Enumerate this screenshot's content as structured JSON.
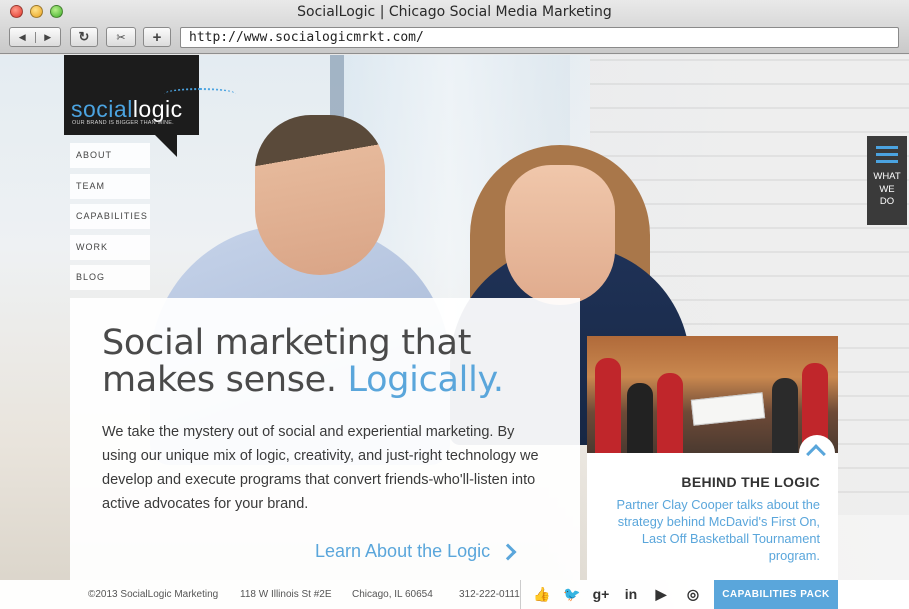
{
  "browser": {
    "window_title": "SocialLogic | Chicago Social Media Marketing",
    "url": "http://www.socialogicmrkt.com/",
    "back_glyph": "◀",
    "forward_glyph": "▶",
    "reload_glyph": "↻",
    "snip_glyph": "✂",
    "add_glyph": "+"
  },
  "logo": {
    "part1": "social",
    "part2": "logic",
    "tagline": "OUR BRAND IS BIGGER THAN MINE."
  },
  "nav": {
    "items": [
      "ABOUT",
      "TEAM",
      "CAPABILITIES",
      "WORK",
      "BLOG"
    ]
  },
  "side_tab": {
    "line1": "WHAT",
    "line2": "WE",
    "line3": "DO",
    "icon": "hamburger-icon"
  },
  "hero": {
    "headline_line1": "Social marketing that",
    "headline_line2": "makes sense.",
    "headline_accent": "Logically.",
    "body": "We take the mystery out of social and experiential marketing. By using our unique mix of logic, creativity, and just-right technology we develop and execute programs that convert friends-who'll-listen into active advocates for your brand.",
    "cta": "Learn About the Logic"
  },
  "feature_card": {
    "title": "BEHIND THE LOGIC",
    "body": "Partner Clay Cooper talks about the strategy behind McDavid's First On, Last Off Basketball Tournament program."
  },
  "footer": {
    "copyright": "©2013 SocialLogic Marketing",
    "address": "118 W Illinois St #2E",
    "city": "Chicago, IL 60654",
    "phone": "312-222-0111",
    "social": [
      {
        "icon": "facebook-like-icon",
        "glyph": "👍"
      },
      {
        "icon": "twitter-icon",
        "glyph": "🐦"
      },
      {
        "icon": "google-plus-icon",
        "glyph": "g+"
      },
      {
        "icon": "linkedin-icon",
        "glyph": "in"
      },
      {
        "icon": "youtube-icon",
        "glyph": "▶"
      },
      {
        "icon": "instagram-icon",
        "glyph": "◎"
      }
    ],
    "cta": "CAPABILITIES PACK"
  },
  "colors": {
    "accent": "#5aa6db",
    "logo_bg": "#1c1c1c",
    "side_tab_bg": "#3a3a3a"
  }
}
